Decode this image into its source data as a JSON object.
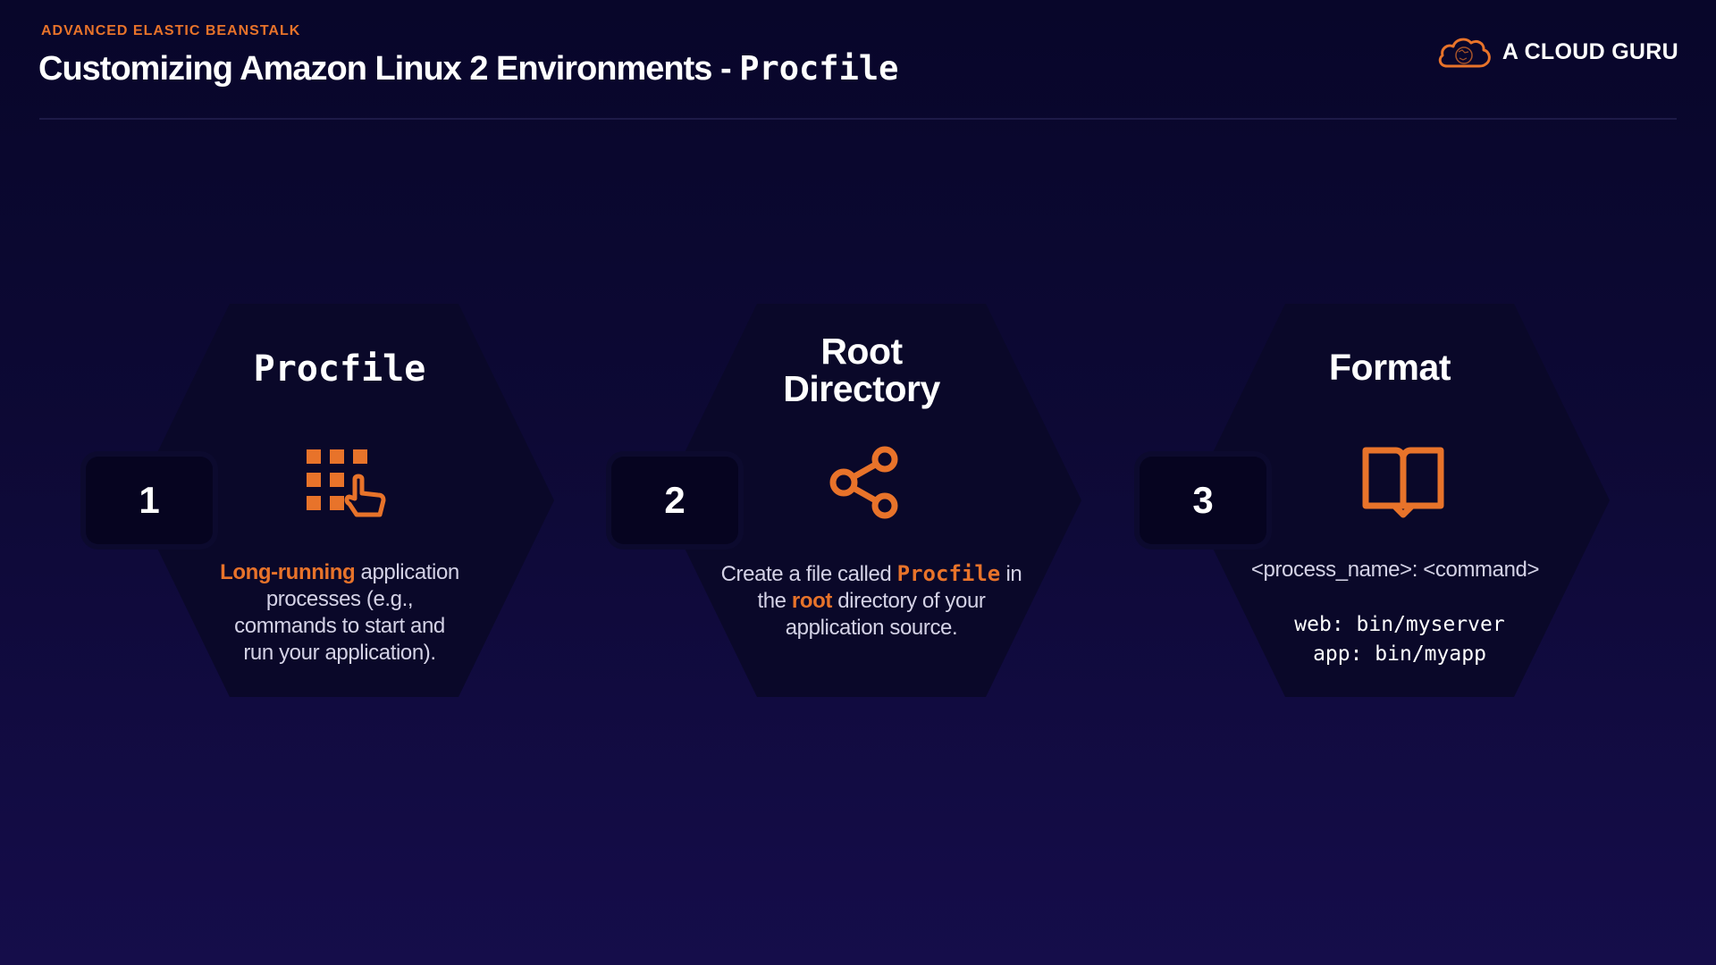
{
  "header": {
    "eyebrow": "ADVANCED ELASTIC BEANSTALK",
    "title_main": "Customizing Amazon Linux 2 Environments - ",
    "title_mono": "Procfile"
  },
  "brand": {
    "name": "A CLOUD GURU",
    "icon": "cloud-logo-icon"
  },
  "colors": {
    "accent": "#e8732a",
    "background": "#0d0935",
    "hexagon": "#0a0829",
    "number_box": "#060420"
  },
  "cards": [
    {
      "number": "1",
      "title": "Procfile",
      "icon": "apps-grid-hand-icon",
      "desc_highlight": "Long-running",
      "desc_line1_rest": " application",
      "desc_line2": "processes (e.g.,",
      "desc_line3": "commands to start and",
      "desc_line4": "run your application)."
    },
    {
      "number": "2",
      "title_line1": "Root",
      "title_line2": "Directory",
      "icon": "share-icon",
      "desc_pre": "Create a file called ",
      "desc_mono": "Procfile",
      "desc_post": " in",
      "desc_line2_pre": "the ",
      "desc_line2_hl": "root",
      "desc_line2_post": " directory of your",
      "desc_line3": "application source."
    },
    {
      "number": "3",
      "title": "Format",
      "icon": "open-book-icon",
      "format_line": "<process_name>: <command>",
      "code_line1": "web: bin/myserver",
      "code_line2": "app: bin/myapp"
    }
  ]
}
